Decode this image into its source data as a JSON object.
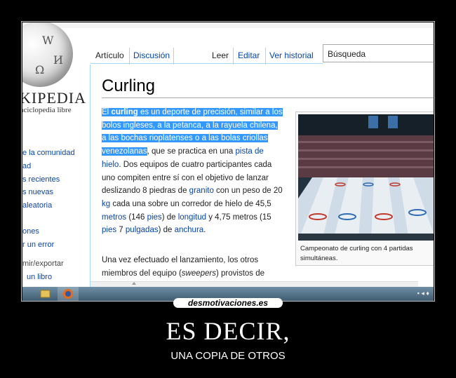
{
  "logo": {
    "glyphs": [
      "W",
      "И",
      "Ω"
    ],
    "wordmark": "KIPEDIA",
    "tagline": "nciclopedia libre"
  },
  "sidebar": {
    "items": [
      {
        "label": "e la comunidad"
      },
      {
        "label": "ad"
      },
      {
        "label": "s recientes"
      },
      {
        "label": "s nuevas"
      },
      {
        "label": "aleatoria"
      },
      {
        "label": "ones"
      },
      {
        "label": "r un error"
      },
      {
        "label": "mir/exportar"
      },
      {
        "label": "un libro"
      }
    ]
  },
  "tabs": {
    "article": "Artículo",
    "discussion": "Discusión",
    "read": "Leer",
    "edit": "Editar",
    "history": "Ver historial"
  },
  "search": {
    "placeholder": "Búsqueda"
  },
  "article": {
    "title": "Curling",
    "p1": {
      "t1": "El ",
      "t2": "curling",
      "t3": " es un deporte de precisión, similar a los ",
      "l1": "bolos ingleses",
      "t4": ", a la ",
      "l2": "petanca",
      "t5": ", a la ",
      "l3": "rayuela chilena",
      "t6": ", a las ",
      "l4": "bochas rioplatenses",
      "t7": " o a las ",
      "l5": "bolas criollas venezolanas",
      "t8": ", que se practica en una ",
      "l6": "pista de hielo",
      "t9": ". Dos equipos de cuatro participantes cada uno compiten entre sí con el objetivo de lanzar deslizando 8 piedras de ",
      "l7": "granito",
      "t10": " con un peso de 20 ",
      "l8": "kg",
      "t11": " cada una sobre un corredor de hielo de 45,5 ",
      "l9": "metros",
      "t12": " (146 ",
      "l10": "pies",
      "t13": ") de ",
      "l11": "longitud",
      "t14": " y 4,75 metros (15 ",
      "l12": "pies",
      "t15": " 7 ",
      "l13": "pulgadas",
      "t16": ") de ",
      "l14": "anchura",
      "t17": "."
    },
    "p2": {
      "t1": "Una vez efectuado el lanzamiento, los otros miembros del equipo (",
      "em": "sweepers",
      "t2": ") provistos de"
    },
    "caption": "Campeonato de curling con 4 partidas simultáneas."
  },
  "poster": {
    "site": "desmotivaciones.es",
    "title": "ES DECIR,",
    "subtitle": "UNA COPIA DE OTROS"
  },
  "colors": {
    "link": "#0645ad",
    "selection": "#3399ff",
    "background": "#000000"
  }
}
